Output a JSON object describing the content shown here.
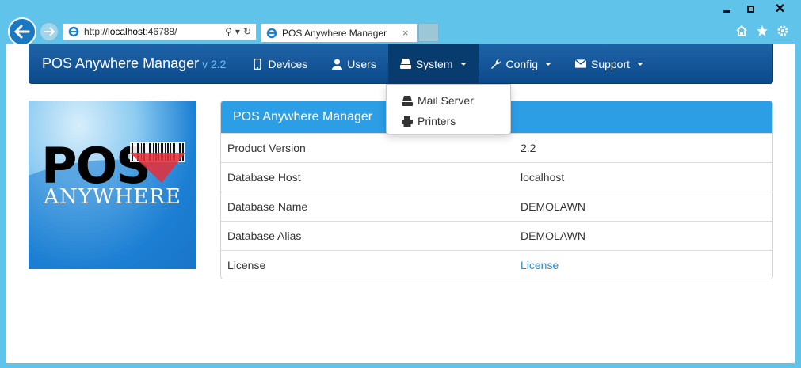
{
  "browser": {
    "url_prefix": "http://",
    "url_host": "localhost",
    "url_rest": ":46788/",
    "tab_title": "POS Anywhere Manager",
    "tab_close": "×"
  },
  "navbar": {
    "brand": "POS Anywhere Manager",
    "version": "v 2.2",
    "items": [
      {
        "label": "Devices",
        "icon": "mobile-icon"
      },
      {
        "label": "Users",
        "icon": "user-icon"
      },
      {
        "label": "System",
        "icon": "hdd-icon",
        "active": true
      },
      {
        "label": "Config",
        "icon": "wrench-icon"
      },
      {
        "label": "Support",
        "icon": "envelope-icon"
      }
    ]
  },
  "dropdown": {
    "items": [
      {
        "label": "Mail Server",
        "icon": "hdd-icon"
      },
      {
        "label": "Printers",
        "icon": "print-icon"
      }
    ]
  },
  "logo": {
    "line1": "POS",
    "line2": "ANYWHERE"
  },
  "panel": {
    "heading": "POS Anywhere Manager",
    "rows": [
      {
        "key": "Product Version",
        "value": "2.2"
      },
      {
        "key": "Database Host",
        "value": "localhost"
      },
      {
        "key": "Database Name",
        "value": "DEMOLAWN"
      },
      {
        "key": "Database Alias",
        "value": "DEMOLAWN"
      },
      {
        "key": "License",
        "value": "License"
      }
    ]
  },
  "colors": {
    "navbar": "#0c4a8a",
    "panel_heading": "#2c9ee6",
    "link": "#2a8ccd"
  }
}
